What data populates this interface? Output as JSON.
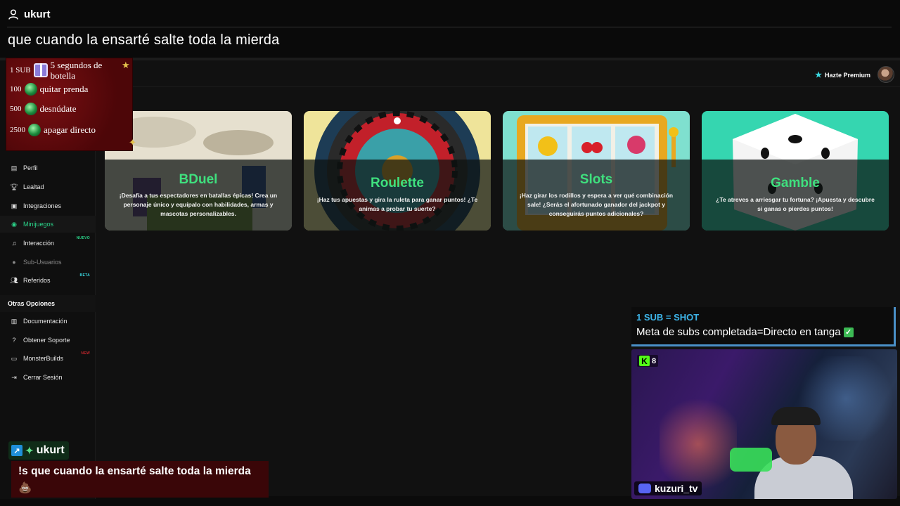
{
  "top_chat": {
    "username": "ukurt",
    "message": "que cuando la ensarté salte toda la mierda"
  },
  "header": {
    "premium_label": "Hazte Premium"
  },
  "sidebar": {
    "items": [
      {
        "label": "Perfil",
        "icon": "id-card-icon"
      },
      {
        "label": "Lealtad",
        "icon": "trophy-icon"
      },
      {
        "label": "Integraciones",
        "icon": "plug-icon"
      },
      {
        "label": "Minijuegos",
        "icon": "gamepad-icon",
        "active": true
      },
      {
        "label": "Interacción",
        "icon": "music-icon",
        "tag": "NUEVO"
      },
      {
        "label": "Sub-Usuarios",
        "icon": "users-icon",
        "muted": true
      },
      {
        "label": "Referidos",
        "icon": "user-group-icon",
        "tag": "BETA"
      }
    ],
    "section_title": "Otras Opciones",
    "other_items": [
      {
        "label": "Documentación",
        "icon": "book-icon"
      },
      {
        "label": "Obtener Soporte",
        "icon": "question-icon"
      },
      {
        "label": "MonsterBuilds",
        "icon": "monitor-icon",
        "tag": "NEW"
      },
      {
        "label": "Cerrar Sesión",
        "icon": "logout-icon"
      }
    ]
  },
  "games": [
    {
      "title": "BDuel",
      "desc": "¡Desafía a tus espectadores en batallas épicas! Crea un personaje único y equípalo con habilidades, armas y mascotas personalizables."
    },
    {
      "title": "Roulette",
      "desc": "¡Haz tus apuestas y gira la ruleta para ganar puntos! ¿Te animas a probar tu suerte?"
    },
    {
      "title": "Slots",
      "desc": "¡Haz girar los rodillos y espera a ver qué combinación sale! ¿Serás el afortunado ganador del jackpot y conseguirás puntos adicionales?"
    },
    {
      "title": "Gamble",
      "desc": "¿Te atreves a arriesgar tu fortuna? ¡Apuesta y descubre si ganas o pierdes puntos!"
    }
  ],
  "goals": [
    {
      "amount": "1 SUB",
      "label": "5 segundos de botella",
      "icon": "gift-icon"
    },
    {
      "amount": "100",
      "label": "quitar prenda",
      "icon": "gem-icon"
    },
    {
      "amount": "500",
      "label": "desnúdate",
      "icon": "gem-icon"
    },
    {
      "amount": "2500",
      "label": "apagar directo",
      "icon": "gem-icon"
    }
  ],
  "chat_popup": {
    "username": "ukurt",
    "message": "!s que cuando la ensarté salte toda la mierda 💩"
  },
  "sub_goal": {
    "heading": "1 SUB = SHOT",
    "text": "Meta de subs completada=Directo en tanga"
  },
  "webcam": {
    "kick_viewers": "8",
    "discord_name": "kuzuri_tv"
  },
  "colors": {
    "accent_green": "#3fe07e",
    "sub_blue": "#3db4e8",
    "kick_green": "#53fc18"
  }
}
